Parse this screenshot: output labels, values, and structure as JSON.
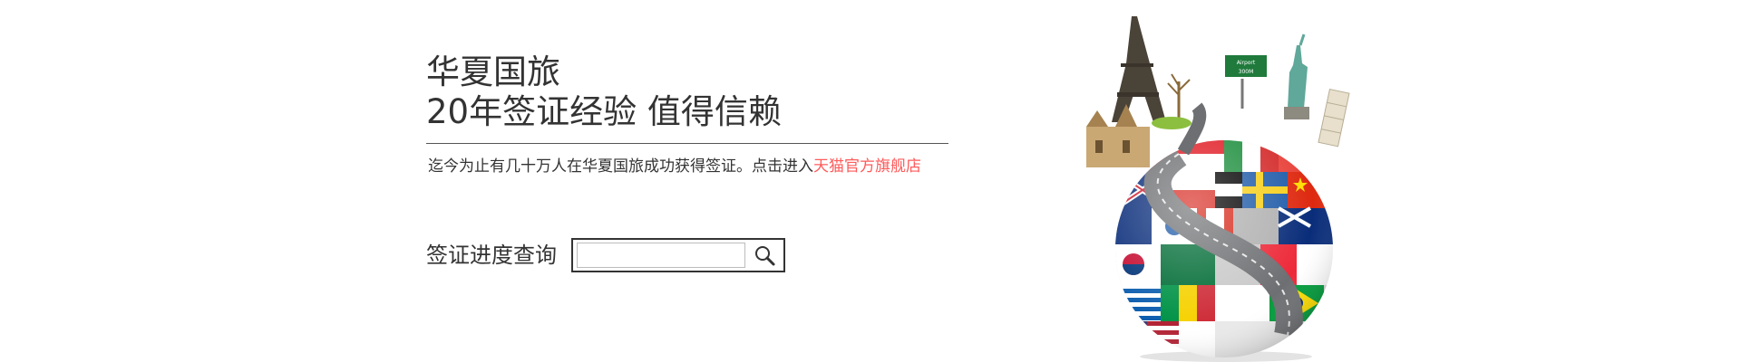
{
  "banner": {
    "brand_name": "华夏国旅",
    "tagline": "20年签证经验 值得信赖",
    "intro_text": "迄今为止有几十万人在华夏国旅成功获得签证。点击进入",
    "intro_link": "天猫官方旗舰店",
    "link_color": "#ff5a5a",
    "text_color": "#333333"
  },
  "query": {
    "label": "签证进度查询",
    "input_value": "",
    "search_icon": "search-icon"
  },
  "illustration": {
    "airport_sign": "Airport 300M",
    "icons": [
      "eiffel-tower-icon",
      "statue-of-liberty-icon",
      "leaning-tower-icon",
      "castle-icon",
      "tree-icon",
      "airport-sign-icon",
      "globe-icon",
      "road-icon",
      "flag-icons"
    ]
  }
}
